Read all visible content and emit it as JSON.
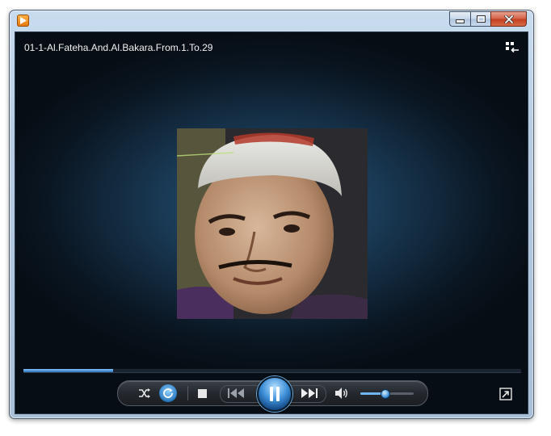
{
  "window": {
    "app_icon": "media-player-icon",
    "caption_buttons": [
      "minimize-icon",
      "maximize-icon",
      "close-icon"
    ]
  },
  "now_playing": {
    "title": "01-1-Al.Fateha.And.Al.Bakara.From.1.To.29",
    "album_art": "portrait of a man wearing a white cap"
  },
  "playback": {
    "state": "playing",
    "progress": 0.18,
    "volume": 0.45,
    "shuffle": false,
    "repeat": true
  },
  "icons": {
    "library": "switch-to-library-icon",
    "shuffle": "shuffle-icon",
    "repeat": "repeat-icon",
    "stop": "stop-icon",
    "previous": "previous-icon",
    "pause": "pause-icon",
    "next": "next-icon",
    "mute": "speaker-icon",
    "fullscreen": "fullscreen-icon"
  },
  "colors": {
    "accent": "#3d8fd8",
    "background": "#0a1622",
    "title_text": "#f2f2f2"
  }
}
